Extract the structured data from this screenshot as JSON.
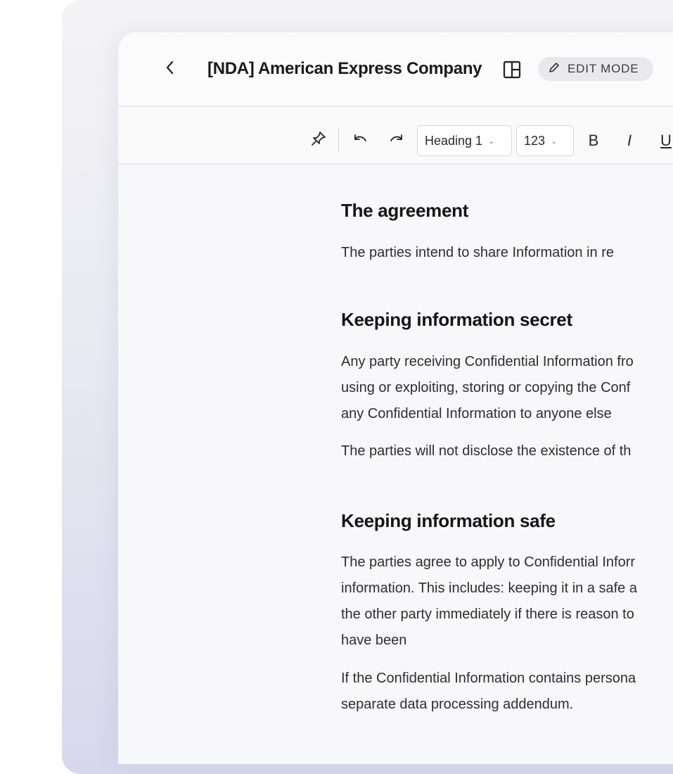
{
  "header": {
    "title": "[NDA] American Express Company",
    "mode_badge": "EDIT MODE"
  },
  "toolbar": {
    "style_select": "Heading 1",
    "size_select": "123",
    "bold_label": "B",
    "italic_label": "I",
    "underline_label": "U"
  },
  "document": {
    "sections": [
      {
        "heading": "The agreement",
        "paragraphs": [
          "The parties intend to share Information in re"
        ]
      },
      {
        "heading": "Keeping information secret",
        "paragraphs": [
          "Any party receiving Confidential Information fro\nusing or exploiting, storing  or copying the Conf\nany Confidential Information to anyone else",
          "The parties will not disclose the existence of th"
        ]
      },
      {
        "heading": "Keeping information safe",
        "paragraphs": [
          "The parties agree to apply to Confidential Inforr\ninformation. This includes: keeping it in a safe a\nthe other party immediately if there is reason to\nhave been",
          "If the Confidential Information contains persona\nseparate data processing addendum."
        ]
      }
    ]
  },
  "icons": [
    "chevron-left-icon",
    "layout-panel-icon",
    "pencil-icon",
    "pin-icon",
    "undo-icon",
    "redo-icon"
  ],
  "colors": {
    "badge_bg": "#e9e9ed",
    "gradient_bottom": "#d7d8ec",
    "text_primary": "#1a1a1a"
  }
}
